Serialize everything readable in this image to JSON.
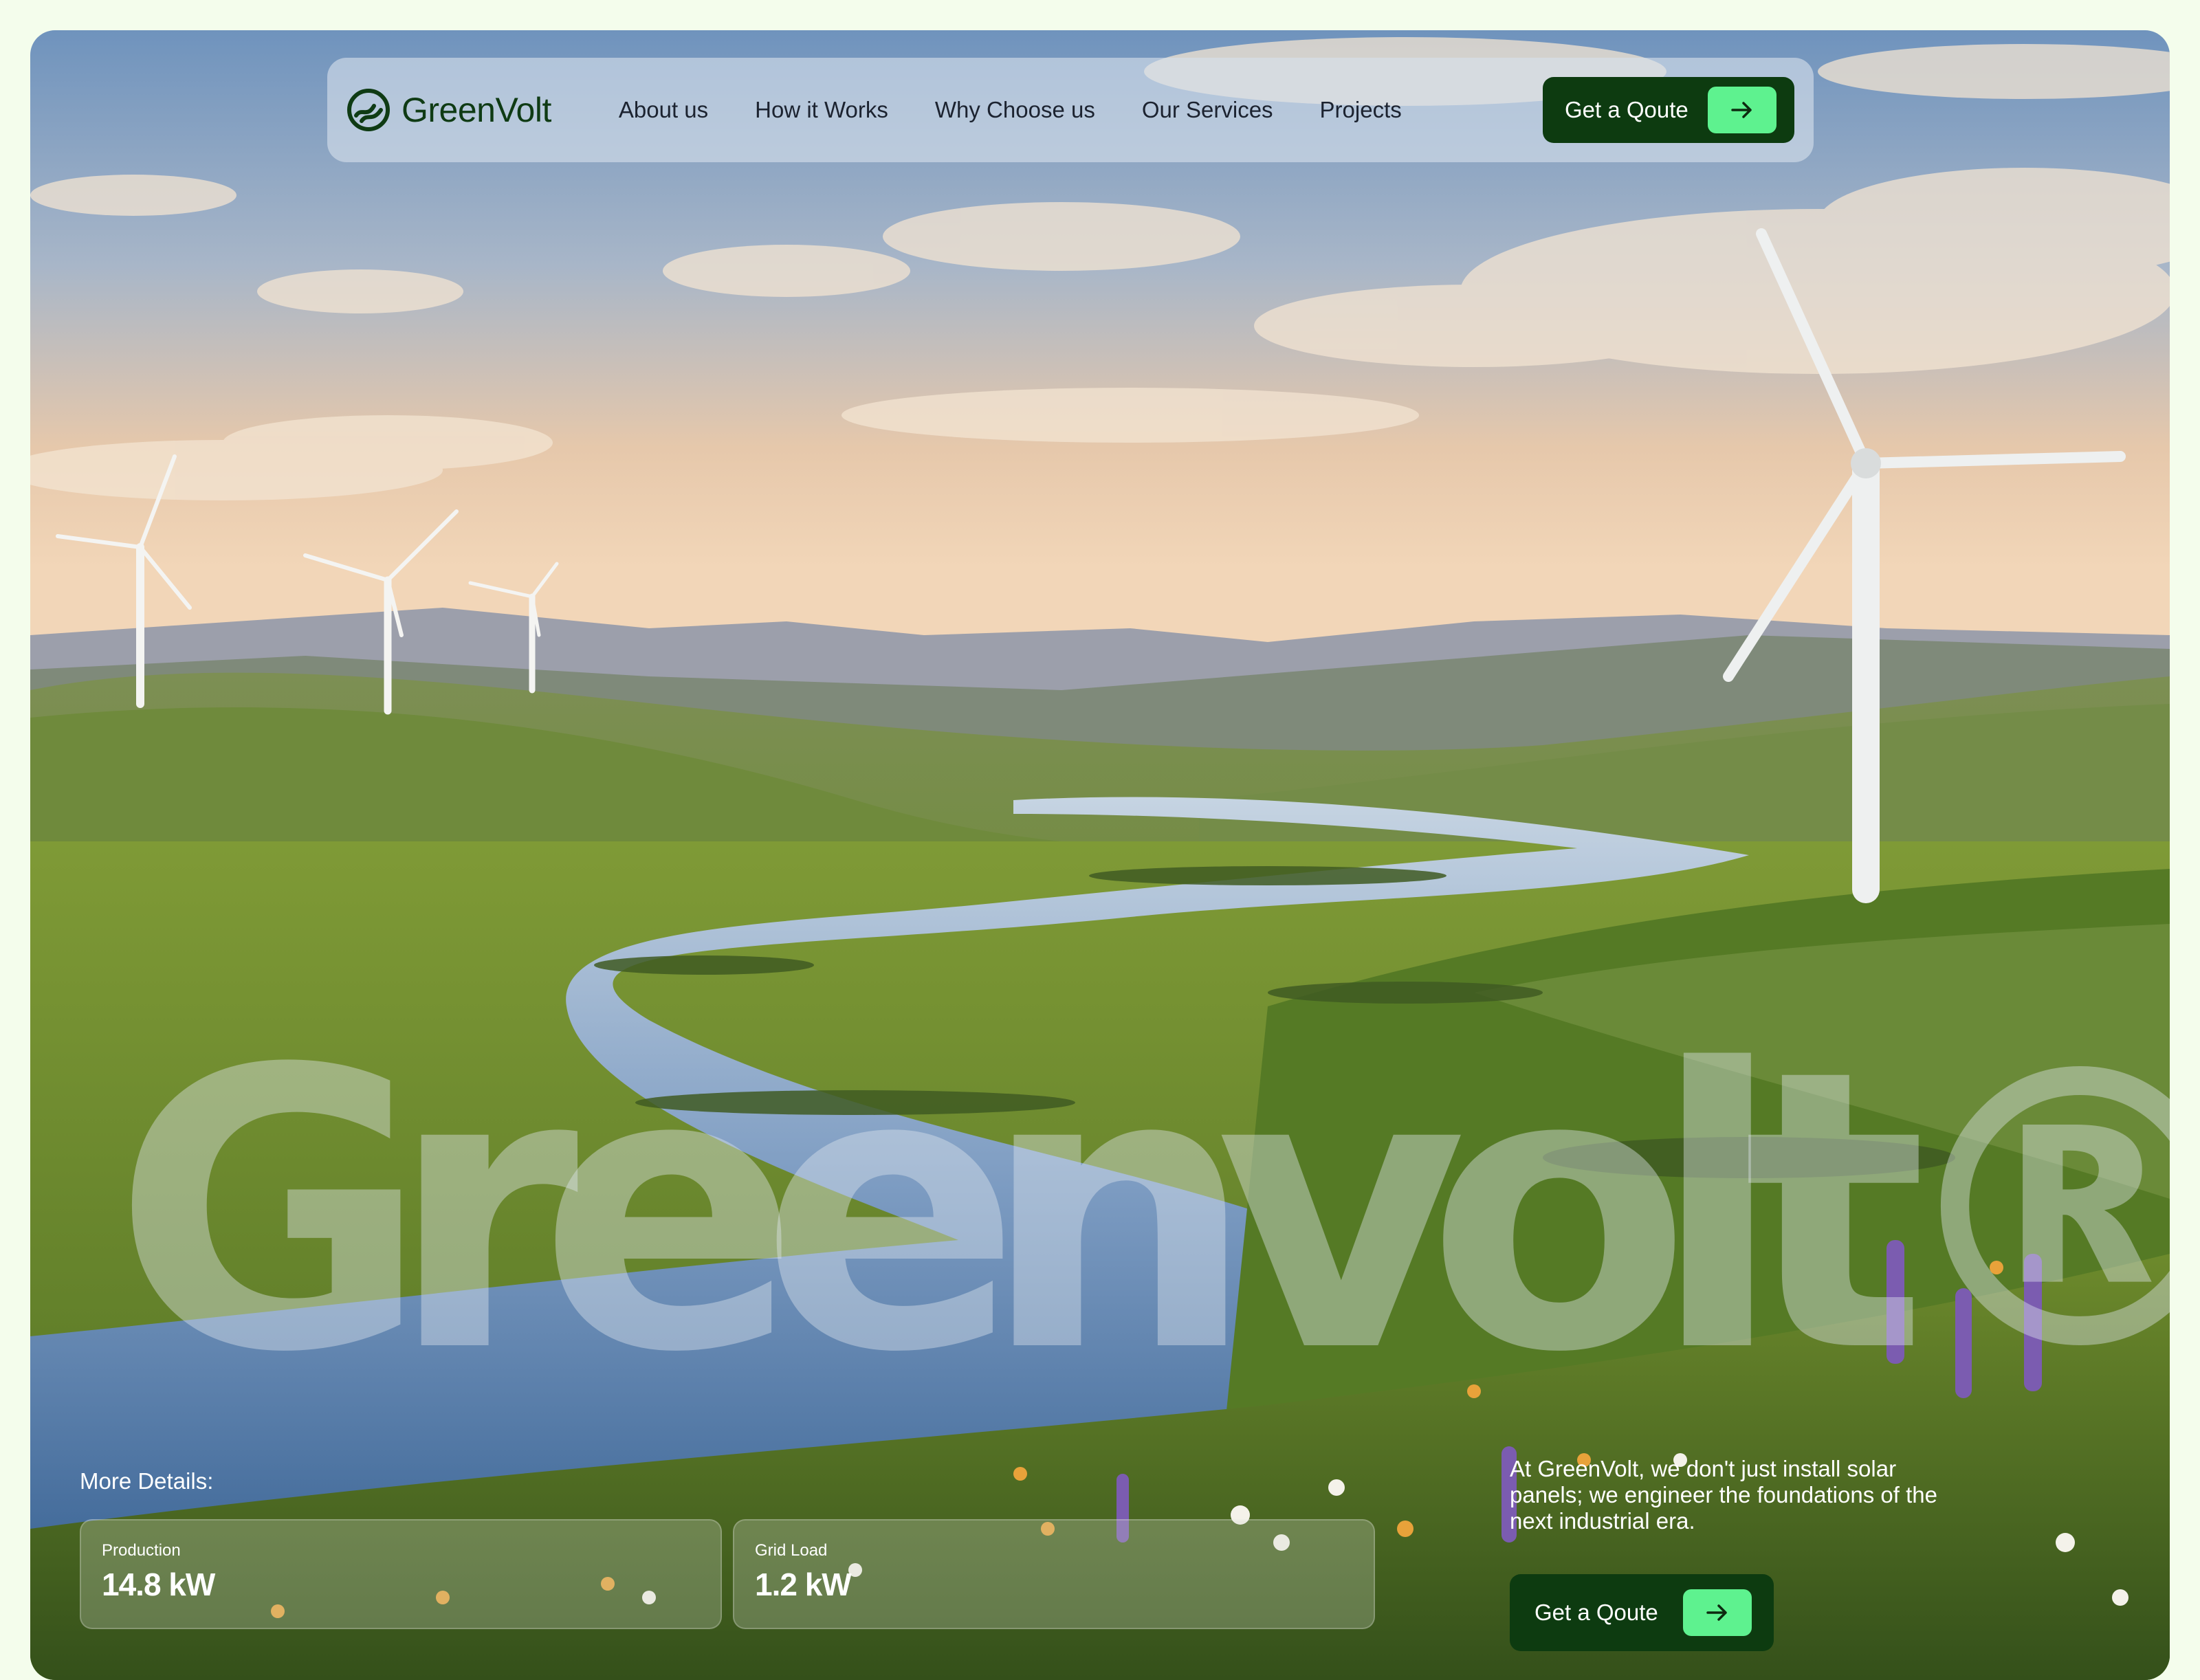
{
  "brand": {
    "name": "GreenVolt",
    "logo_icon": "wave-leaf-icon"
  },
  "nav": {
    "links": [
      "About us",
      "How it Works",
      "Why Choose us",
      "Our Services",
      "Projects"
    ],
    "cta_label": "Get a Qoute",
    "cta_icon": "arrow-right-icon"
  },
  "hero": {
    "wordmark": "Greenvolt®",
    "details_label": "More Details:",
    "stats": [
      {
        "label": "Production",
        "value": "14.8 kW"
      },
      {
        "label": "Grid Load",
        "value": "1.2 kW"
      }
    ],
    "tagline": "At GreenVolt, we don't just install solar panels; we engineer the foundations of the next industrial era.",
    "cta_label": "Get a Qoute",
    "cta_icon": "arrow-right-icon"
  },
  "colors": {
    "page_bg": "#f4fdec",
    "brand_dark": "#0d3b10",
    "accent": "#5ef28f"
  }
}
